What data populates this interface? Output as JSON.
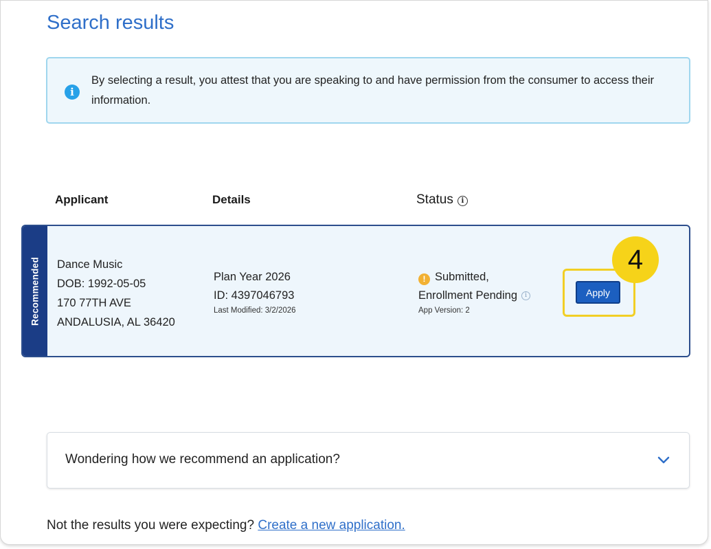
{
  "page": {
    "title": "Search results"
  },
  "notice": {
    "icon": "info-icon",
    "text": "By selecting a result, you attest that you are speaking to and have permission from the consumer to access their information."
  },
  "table": {
    "headers": {
      "applicant": "Applicant",
      "details": "Details",
      "status": "Status"
    }
  },
  "result": {
    "badge": "Recommended",
    "applicant": {
      "name": "Dance Music",
      "dob": "DOB: 1992-05-05",
      "address_line1": "170 77TH AVE",
      "address_line2": "ANDALUSIA, AL 36420"
    },
    "details": {
      "plan_year": "Plan Year 2026",
      "id": "ID: 4397046793",
      "last_modified": "Last Modified: 3/2/2026"
    },
    "status": {
      "line1": "Submitted,",
      "line2": "Enrollment Pending",
      "app_version": "App Version: 2"
    },
    "action_label": "Apply"
  },
  "annotation": {
    "step_number": "4",
    "highlight_color": "#f2cf24"
  },
  "accordion": {
    "label": "Wondering how we recommend an application?"
  },
  "footer": {
    "prompt": "Not the results you were expecting?",
    "link_text": "Create a new application."
  },
  "colors": {
    "title_blue": "#2f6fc9",
    "info_blue": "#27a1e8",
    "recommended_navy": "#1b3d86",
    "button_blue": "#1c5fc0",
    "warning_amber": "#f2b133"
  }
}
